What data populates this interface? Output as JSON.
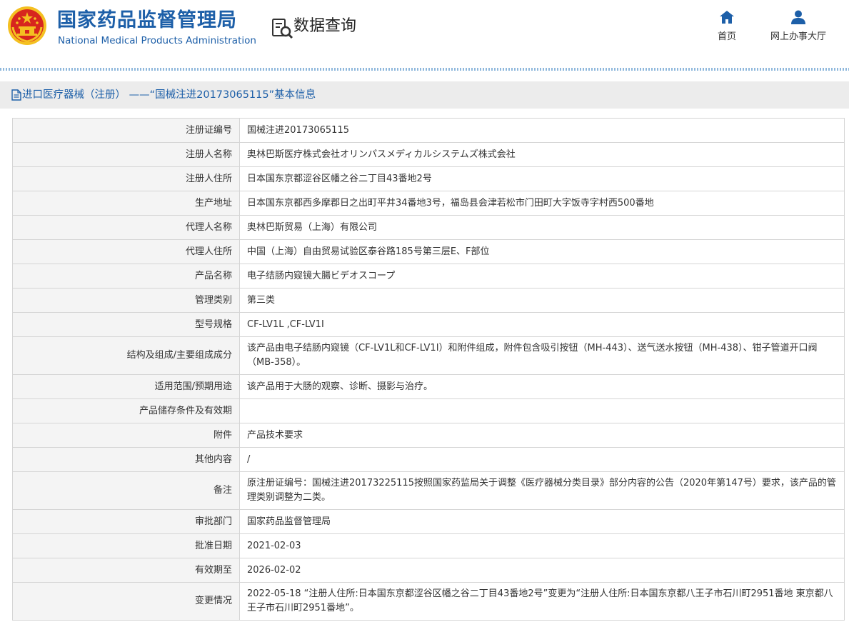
{
  "header": {
    "org_name_cn": "国家药品监督管理局",
    "org_name_en": "National Medical Products Administration",
    "query_label": "数据查询",
    "nav": [
      {
        "label": "首页",
        "icon": "home-icon"
      },
      {
        "label": "网上办事大厅",
        "icon": "user-icon"
      }
    ]
  },
  "page": {
    "title": "进口医疗器械（注册） ——“国械注进20173065115”基本信息"
  },
  "rows": [
    {
      "label": "注册证编号",
      "value": "国械注进20173065115"
    },
    {
      "label": "注册人名称",
      "value": "奥林巴斯医疗株式会社オリンパスメディカルシステムズ株式会社"
    },
    {
      "label": "注册人住所",
      "value": "日本国东京都涩谷区幡之谷二丁目43番地2号"
    },
    {
      "label": "生产地址",
      "value": "日本国东京都西多摩郡日之出町平井34番地3号，福岛县会津若松市门田町大字饭寺字村西500番地"
    },
    {
      "label": "代理人名称",
      "value": "奥林巴斯贸易（上海）有限公司"
    },
    {
      "label": "代理人住所",
      "value": "中国（上海）自由贸易试验区泰谷路185号第三层E、F部位"
    },
    {
      "label": "产品名称",
      "value": "电子结肠内窥镜大腸ビデオスコープ"
    },
    {
      "label": "管理类别",
      "value": "第三类"
    },
    {
      "label": "型号规格",
      "value": "CF-LV1L ,CF-LV1I"
    },
    {
      "label": "结构及组成/主要组成成分",
      "value": "该产品由电子结肠内窥镜（CF-LV1L和CF-LV1I）和附件组成，附件包含吸引按钮（MH-443）、送气送水按钮（MH-438）、钳子管道开口阀（MB-358）。"
    },
    {
      "label": "适用范围/预期用途",
      "value": "该产品用于大肠的观察、诊断、摄影与治疗。"
    },
    {
      "label": "产品储存条件及有效期",
      "value": ""
    },
    {
      "label": "附件",
      "value": "产品技术要求"
    },
    {
      "label": "其他内容",
      "value": "/"
    },
    {
      "label": "备注",
      "value": "原注册证编号：国械注进20173225115按照国家药监局关于调整《医疗器械分类目录》部分内容的公告（2020年第147号）要求，该产品的管理类别调整为二类。"
    },
    {
      "label": "审批部门",
      "value": "国家药品监督管理局"
    },
    {
      "label": "批准日期",
      "value": "2021-02-03"
    },
    {
      "label": "有效期至",
      "value": "2026-02-02"
    },
    {
      "label": "变更情况",
      "value": "2022-05-18 “注册人住所:日本国东京都涩谷区幡之谷二丁目43番地2号”变更为“注册人住所:日本国东京都八王子市石川町2951番地 東京都八王子市石川町2951番地”。"
    }
  ],
  "colors": {
    "brand_blue": "#1d5fa8",
    "label_bg": "#f4f4f4",
    "title_bar_bg": "#ececec",
    "border": "#d5d5d5",
    "emblem_red": "#d7261e",
    "emblem_gold": "#f4c021"
  }
}
